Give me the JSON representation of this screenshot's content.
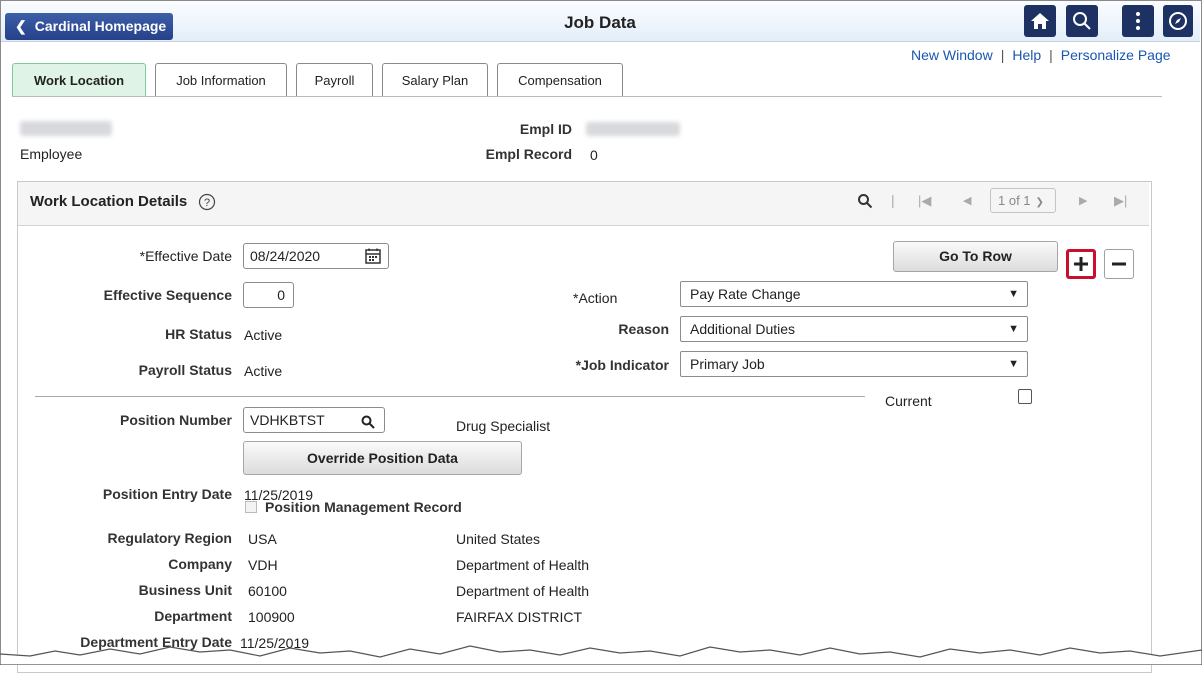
{
  "header": {
    "back_label": "Cardinal Homepage",
    "title": "Job Data",
    "icons": [
      "home-icon",
      "search-icon",
      "actions-menu-icon",
      "navbar-compass-icon"
    ]
  },
  "links": {
    "new_window": "New Window",
    "help": "Help",
    "personalize": "Personalize Page"
  },
  "tabs": [
    {
      "label": "Work Location",
      "active": true
    },
    {
      "label": "Job Information",
      "active": false
    },
    {
      "label": "Payroll",
      "active": false
    },
    {
      "label": "Salary Plan",
      "active": false
    },
    {
      "label": "Compensation",
      "active": false
    }
  ],
  "employee": {
    "type": "Employee",
    "empl_id_label": "Empl ID",
    "empl_record_label": "Empl Record",
    "empl_record_value": "0"
  },
  "section": {
    "title": "Work Location Details",
    "help_icon": "help-icon",
    "pager": "1 of 1"
  },
  "fields": {
    "effective_date_label": "*Effective Date",
    "effective_date_value": "08/24/2020",
    "effective_sequence_label": "Effective Sequence",
    "effective_sequence_value": "0",
    "hr_status_label": "HR Status",
    "hr_status_value": "Active",
    "payroll_status_label": "Payroll Status",
    "payroll_status_value": "Active",
    "action_label": "*Action",
    "action_value": "Pay Rate Change",
    "reason_label": "Reason",
    "reason_value": "Additional Duties",
    "job_indicator_label": "*Job Indicator",
    "job_indicator_value": "Primary Job",
    "current_label": "Current",
    "go_to_row": "Go To Row",
    "position_number_label": "Position Number",
    "position_number_value": "VDHKBTST",
    "position_title": "Drug Specialist",
    "override_button": "Override Position Data",
    "position_entry_date_label": "Position Entry Date",
    "position_entry_date_value": "11/25/2019",
    "position_mgmt_label": "Position Management Record",
    "regulatory_region_label": "Regulatory Region",
    "regulatory_region_value": "USA",
    "regulatory_region_desc": "United States",
    "company_label": "Company",
    "company_value": "VDH",
    "company_desc": "Department of Health",
    "business_unit_label": "Business Unit",
    "business_unit_value": "60100",
    "business_unit_desc": "Department of Health",
    "department_label": "Department",
    "department_value": "100900",
    "department_desc": "FAIRFAX DISTRICT",
    "department_entry_date_label": "Department Entry Date",
    "department_entry_date_value": "11/25/2019"
  },
  "colors": {
    "header_button": "#25418a",
    "active_tab": "#dff4e6",
    "link": "#1a56b0",
    "highlight": "#c8102e"
  }
}
